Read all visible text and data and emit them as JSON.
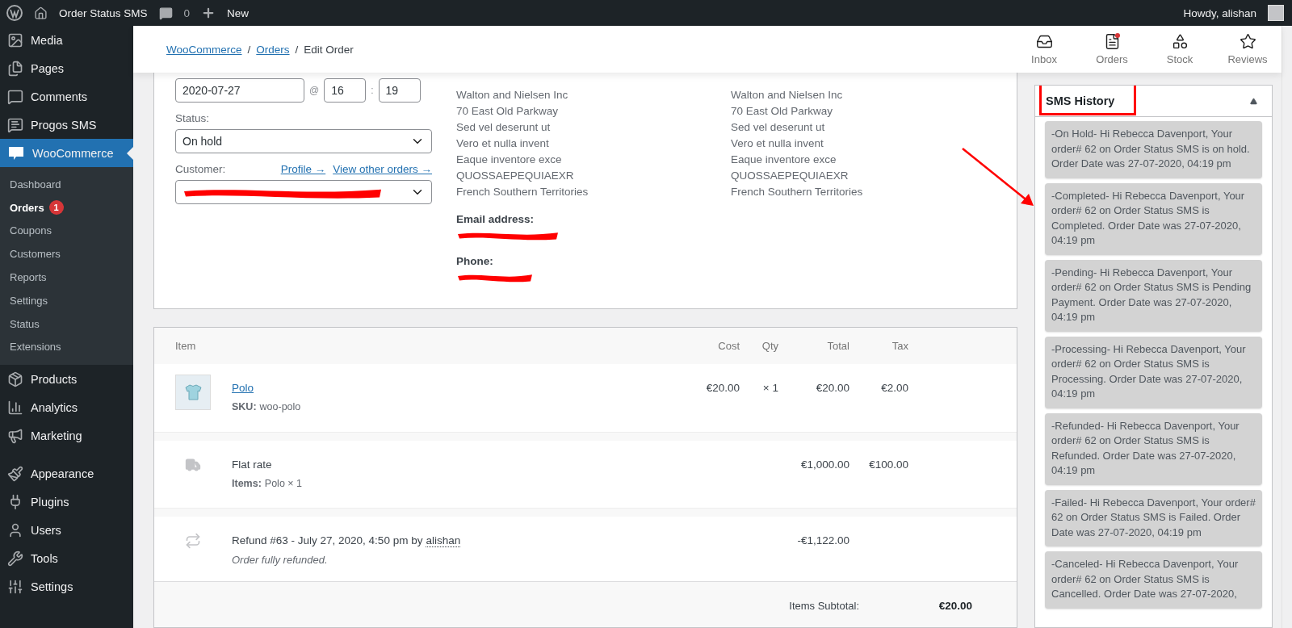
{
  "admin_bar": {
    "site_title": "Order Status SMS",
    "comments_count": "0",
    "new_label": "New",
    "greeting": "Howdy, alishan"
  },
  "sidebar": {
    "items": [
      {
        "label": "Media",
        "selected": false
      },
      {
        "label": "Pages",
        "selected": false
      },
      {
        "label": "Comments",
        "selected": false
      },
      {
        "label": "Progos SMS",
        "selected": false
      },
      {
        "label": "WooCommerce",
        "selected": true,
        "children": [
          {
            "label": "Dashboard",
            "selected": false
          },
          {
            "label": "Orders",
            "selected": true,
            "badge": "1"
          },
          {
            "label": "Coupons",
            "selected": false
          },
          {
            "label": "Customers",
            "selected": false
          },
          {
            "label": "Reports",
            "selected": false
          },
          {
            "label": "Settings",
            "selected": false
          },
          {
            "label": "Status",
            "selected": false
          },
          {
            "label": "Extensions",
            "selected": false
          }
        ]
      },
      {
        "label": "Products",
        "selected": false
      },
      {
        "label": "Analytics",
        "selected": false
      },
      {
        "label": "Marketing",
        "selected": false
      },
      {
        "label": "Appearance",
        "selected": false
      },
      {
        "label": "Plugins",
        "selected": false
      },
      {
        "label": "Users",
        "selected": false
      },
      {
        "label": "Tools",
        "selected": false
      },
      {
        "label": "Settings",
        "selected": false
      }
    ]
  },
  "header": {
    "separator": "/",
    "breadcrumbs": [
      {
        "label": "WooCommerce",
        "link": true
      },
      {
        "label": "Orders",
        "link": true
      },
      {
        "label": "Edit Order",
        "link": false
      }
    ],
    "activity": [
      {
        "label": "Inbox",
        "notification": false
      },
      {
        "label": "Orders",
        "notification": true
      },
      {
        "label": "Stock",
        "notification": false
      },
      {
        "label": "Reviews",
        "notification": false
      }
    ]
  },
  "order": {
    "date": "2020-07-27",
    "date_separator": "@",
    "hour": "16",
    "time_separator": ":",
    "minute": "19",
    "status_label": "Status:",
    "status": "On hold",
    "customer_label": "Customer:",
    "profile_link": "Profile →",
    "orders_link": "View other orders →",
    "billing": {
      "lines": [
        "Walton and Nielsen Inc",
        "70 East Old Parkway",
        "Sed vel deserunt ut",
        "Vero et nulla invent",
        "Eaque inventore exce",
        "QUOSSAEPEQUIAEXR",
        "French Southern Territories"
      ],
      "email_label": "Email address:",
      "phone_label": "Phone:"
    },
    "shipping": {
      "lines": [
        "Walton and Nielsen Inc",
        "70 East Old Parkway",
        "Sed vel deserunt ut",
        "Vero et nulla invent",
        "Eaque inventore exce",
        "QUOSSAEPEQUIAEXR",
        "French Southern Territories"
      ]
    }
  },
  "items": {
    "columns": [
      "Item",
      "Cost",
      "Qty",
      "Total",
      "Tax"
    ],
    "rows": [
      {
        "kind": "product",
        "name": "Polo",
        "meta_label": "SKU:",
        "meta": "woo-polo",
        "cost": "€20.00",
        "qty": "× 1",
        "total": "€20.00",
        "tax": "€2.00"
      },
      {
        "kind": "shipping",
        "name": "Flat rate",
        "meta_label": "Items:",
        "meta": "Polo × 1",
        "total": "€1,000.00",
        "tax": "€100.00"
      },
      {
        "kind": "refund",
        "name": "Refund #63 - July 27, 2020, 4:50 pm by",
        "author": "alishan",
        "note": "Order fully refunded.",
        "total": "-€1,122.00"
      }
    ],
    "totals": [
      {
        "label": "Items Subtotal:",
        "value": "€20.00"
      }
    ]
  },
  "sms_history": {
    "title": "SMS History",
    "expanded": true,
    "messages": [
      "-On Hold- Hi Rebecca Davenport, Your order# 62 on Order Status SMS is on hold. Order Date was 27-07-2020, 04:19 pm",
      "-Completed- Hi Rebecca Davenport, Your order# 62 on Order Status SMS is Completed. Order Date was 27-07-2020, 04:19 pm",
      "-Pending- Hi Rebecca Davenport, Your order# 62 on Order Status SMS is Pending Payment. Order Date was 27-07-2020, 04:19 pm",
      "-Processing- Hi Rebecca Davenport, Your order# 62 on Order Status SMS is Processing. Order Date was 27-07-2020, 04:19 pm",
      "-Refunded- Hi Rebecca Davenport, Your order# 62 on Order Status SMS is Refunded. Order Date was 27-07-2020, 04:19 pm",
      "-Failed- Hi Rebecca Davenport, Your order# 62 on Order Status SMS is Failed. Order Date was 27-07-2020, 04:19 pm",
      "-Canceled- Hi Rebecca Davenport, Your order# 62 on Order Status SMS is Cancelled. Order Date was 27-07-2020,"
    ]
  }
}
